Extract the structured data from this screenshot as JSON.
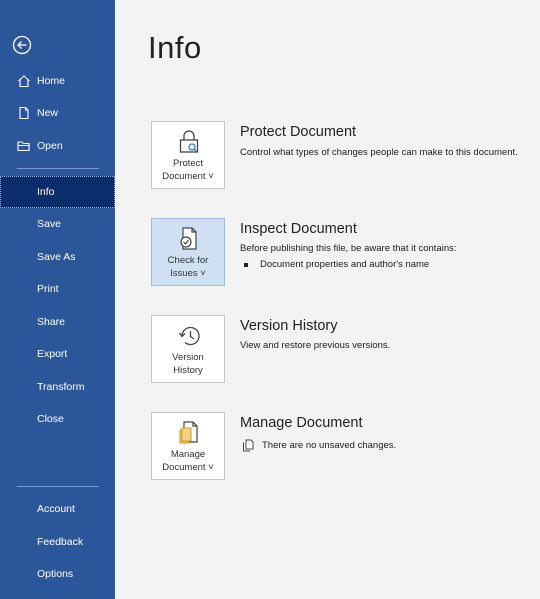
{
  "sidebar": {
    "items": [
      {
        "label": "Home"
      },
      {
        "label": "New"
      },
      {
        "label": "Open"
      },
      {
        "label": "Info"
      },
      {
        "label": "Save"
      },
      {
        "label": "Save As"
      },
      {
        "label": "Print"
      },
      {
        "label": "Share"
      },
      {
        "label": "Export"
      },
      {
        "label": "Transform"
      },
      {
        "label": "Close"
      }
    ],
    "footer": [
      {
        "label": "Account"
      },
      {
        "label": "Feedback"
      },
      {
        "label": "Options"
      }
    ],
    "active": "Info",
    "colors": {
      "background": "#2b579a",
      "active": "#0c2d6b"
    }
  },
  "main": {
    "title": "Info",
    "sections": [
      {
        "button_line1": "Protect",
        "button_line2": "Document ˅",
        "title": "Protect Document",
        "description": "Control what types of changes people can make to this document.",
        "icon": "lock-icon"
      },
      {
        "button_line1": "Check for",
        "button_line2": "Issues ˅",
        "title": "Inspect Document",
        "description": "Before publishing this file, be aware that it contains:",
        "bullets": [
          "Document properties and author's name"
        ],
        "icon": "inspect-document-icon"
      },
      {
        "button_line1": "Version",
        "button_line2": "History",
        "title": "Version History",
        "description": "View and restore previous versions.",
        "icon": "history-icon"
      },
      {
        "button_line1": "Manage",
        "button_line2": "Document ˅",
        "title": "Manage Document",
        "description": "There are no unsaved changes.",
        "icon": "manage-document-icon"
      }
    ]
  }
}
